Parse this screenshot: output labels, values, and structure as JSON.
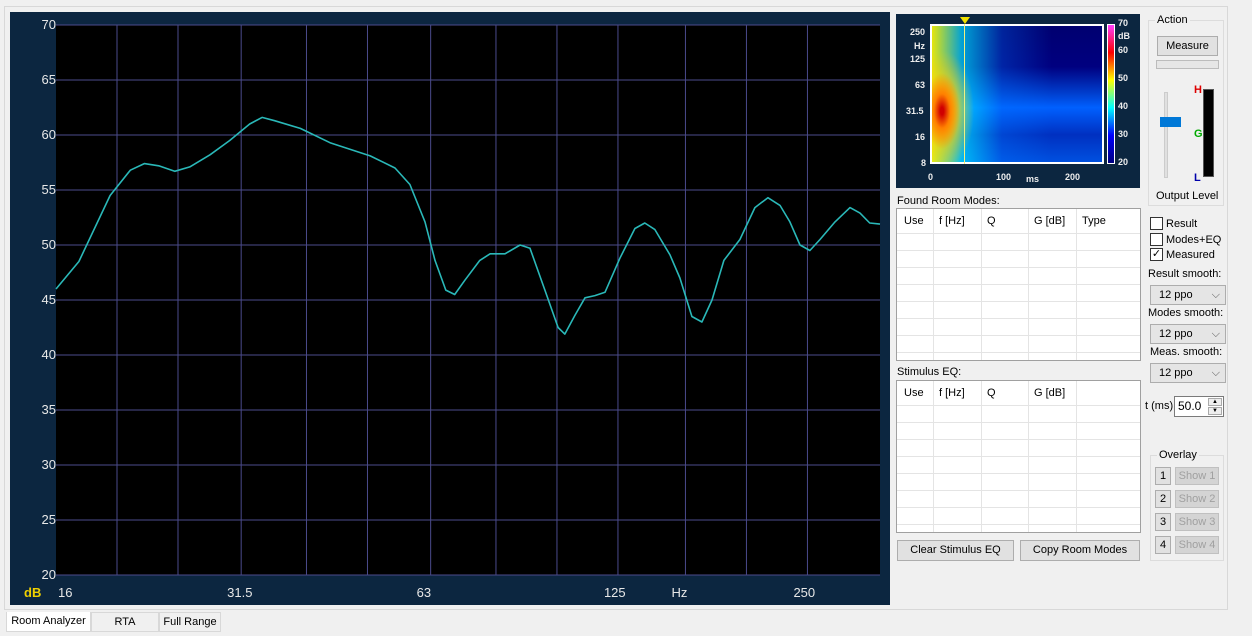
{
  "chart_data": {
    "type": "line",
    "title": "",
    "xlabel": "Hz",
    "ylabel": "dB",
    "xscale": "log",
    "xlim": [
      16,
      326
    ],
    "ylim": [
      20,
      70
    ],
    "yticks": [
      20,
      25,
      30,
      35,
      40,
      45,
      50,
      55,
      60,
      65,
      70
    ],
    "xtick_labels": [
      {
        "v": 16,
        "t": "16"
      },
      {
        "v": 31.5,
        "t": "31.5"
      },
      {
        "v": 63,
        "t": "63"
      },
      {
        "v": 125,
        "t": "125"
      },
      {
        "v": 160,
        "t": "Hz"
      },
      {
        "v": 250,
        "t": "250"
      }
    ],
    "xgrid": [
      20,
      25,
      31.5,
      40,
      50,
      63,
      80,
      100,
      125,
      160,
      200,
      250
    ],
    "grid": true,
    "series": [
      {
        "name": "Measured",
        "color": "#2ab8b8",
        "x": [
          16,
          17.4,
          19.5,
          21.0,
          22.1,
          23.3,
          24.7,
          26.1,
          28.1,
          30.2,
          32.5,
          34.0,
          35.6,
          39.1,
          43.6,
          50.5,
          55.3,
          58.4,
          61.7,
          64,
          66.6,
          68.8,
          71.4,
          75.4,
          78.3,
          82.7,
          87.4,
          90.6,
          95.7,
          100.4,
          102.9,
          106.8,
          110.8,
          114.9,
          119.2,
          125.9,
          133.0,
          137.9,
          143.1,
          151.2,
          156.8,
          163.8,
          169.9,
          176.3,
          184.2,
          195.3,
          206.3,
          216.3,
          226.1,
          234.5,
          243.3,
          252.3,
          261.8,
          276.5,
          292.1,
          303,
          314,
          326
        ],
        "y": [
          46.0,
          48.5,
          54.5,
          56.8,
          57.4,
          57.2,
          56.7,
          57.1,
          58.2,
          59.5,
          61.0,
          61.6,
          61.3,
          60.6,
          59.3,
          58.1,
          57.0,
          55.5,
          52.1,
          48.6,
          45.9,
          45.5,
          46.8,
          48.6,
          49.2,
          49.2,
          50.0,
          49.7,
          45.9,
          42.5,
          41.9,
          43.6,
          45.2,
          45.4,
          45.7,
          48.8,
          51.5,
          52.0,
          51.4,
          49.1,
          47.0,
          43.5,
          43.0,
          45.0,
          48.6,
          50.5,
          53.4,
          54.3,
          53.6,
          52.1,
          50.0,
          49.5,
          50.5,
          52.1,
          53.4,
          52.9,
          52.0,
          51.9
        ]
      }
    ]
  },
  "spectrogram": {
    "y_ticks": [
      "250",
      "125",
      "63",
      "31.5",
      "16",
      "8"
    ],
    "y_unit": "Hz",
    "x_ticks": [
      "0",
      "100",
      "200"
    ],
    "x_unit": "ms",
    "scale_ticks": [
      "70",
      "60",
      "50",
      "40",
      "30",
      "20"
    ],
    "scale_unit": "dB"
  },
  "action": {
    "title": "Action",
    "measure": "Measure",
    "output_level": "Output Level",
    "level_h": "H",
    "level_g": "G",
    "level_l": "L"
  },
  "modes": {
    "title": "Found Room Modes:",
    "cols": [
      "Use",
      "f [Hz]",
      "Q",
      "G [dB]",
      "Type"
    ]
  },
  "eq": {
    "title": "Stimulus EQ:",
    "cols": [
      "Use",
      "f [Hz]",
      "Q",
      "G [dB]"
    ]
  },
  "buttons": {
    "clear": "Clear Stimulus EQ",
    "copy": "Copy Room Modes"
  },
  "options": {
    "result": "Result",
    "modes_eq": "Modes+EQ",
    "measured": "Measured",
    "check": "✓",
    "result_smooth": "Result smooth:",
    "result_smooth_val": "12 ppo",
    "modes_smooth": "Modes smooth:",
    "modes_smooth_val": "12 ppo",
    "meas_smooth": "Meas. smooth:",
    "meas_smooth_val": "12 ppo",
    "t_label": "t (ms)",
    "t_val": "50.0"
  },
  "overlay": {
    "title": "Overlay",
    "items": [
      {
        "n": "1",
        "s": "Show 1"
      },
      {
        "n": "2",
        "s": "Show 2"
      },
      {
        "n": "3",
        "s": "Show 3"
      },
      {
        "n": "4",
        "s": "Show 4"
      }
    ]
  },
  "tabs": [
    "Room Analyzer",
    "RTA",
    "Full Range"
  ],
  "dB_label": "dB"
}
